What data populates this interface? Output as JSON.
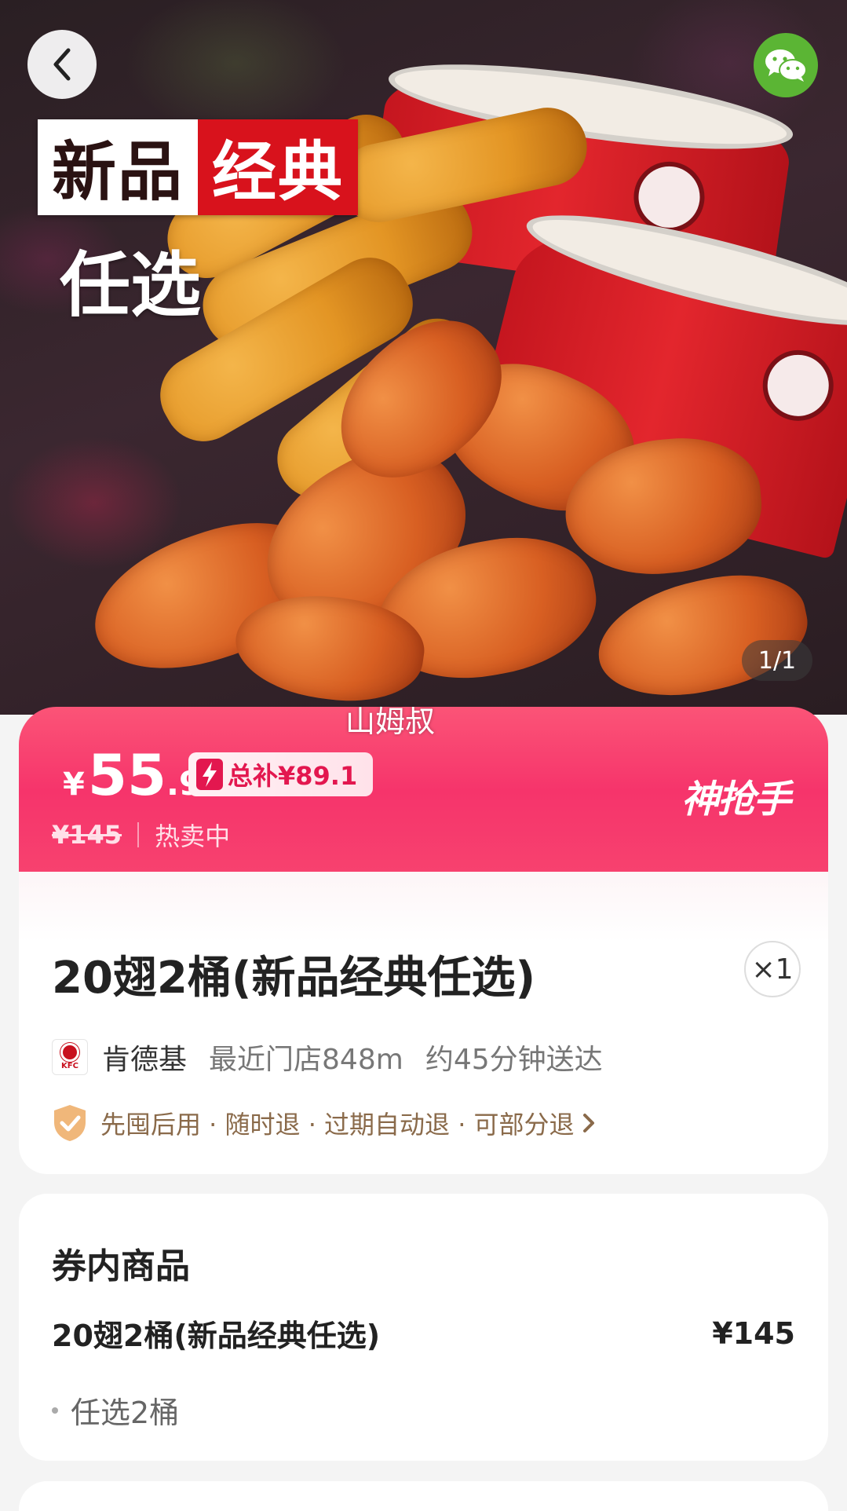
{
  "hero": {
    "promo_word1": "新品",
    "promo_word2": "经典",
    "promo_sub": "任选",
    "image_counter": "1/1",
    "watermark": "山姆叔"
  },
  "nav": {
    "back_icon": "chevron-left-icon",
    "share_icon": "wechat-icon"
  },
  "price": {
    "currency": "¥",
    "integer": "55",
    "decimal": ".9",
    "subsidy_label": "总补¥89.1",
    "original": "¥145",
    "status": "热卖中",
    "brand": "神抢手"
  },
  "product": {
    "title": "20翅2桶(新品经典任选)",
    "quantity": "×1",
    "store_name": "肯德基",
    "store_distance": "最近门店848m",
    "delivery_time": "约45分钟送达",
    "policy": "先囤后用 · 随时退 · 过期自动退 · 可部分退"
  },
  "voucher_items": {
    "section_title": "券内商品",
    "items": [
      {
        "name": "20翅2桶(新品经典任选)",
        "price": "¥145",
        "detail": "任选2桶"
      }
    ]
  },
  "colors": {
    "accent": "#f6346b",
    "wechat": "#5bb534",
    "kfc_red": "#c8101e"
  }
}
